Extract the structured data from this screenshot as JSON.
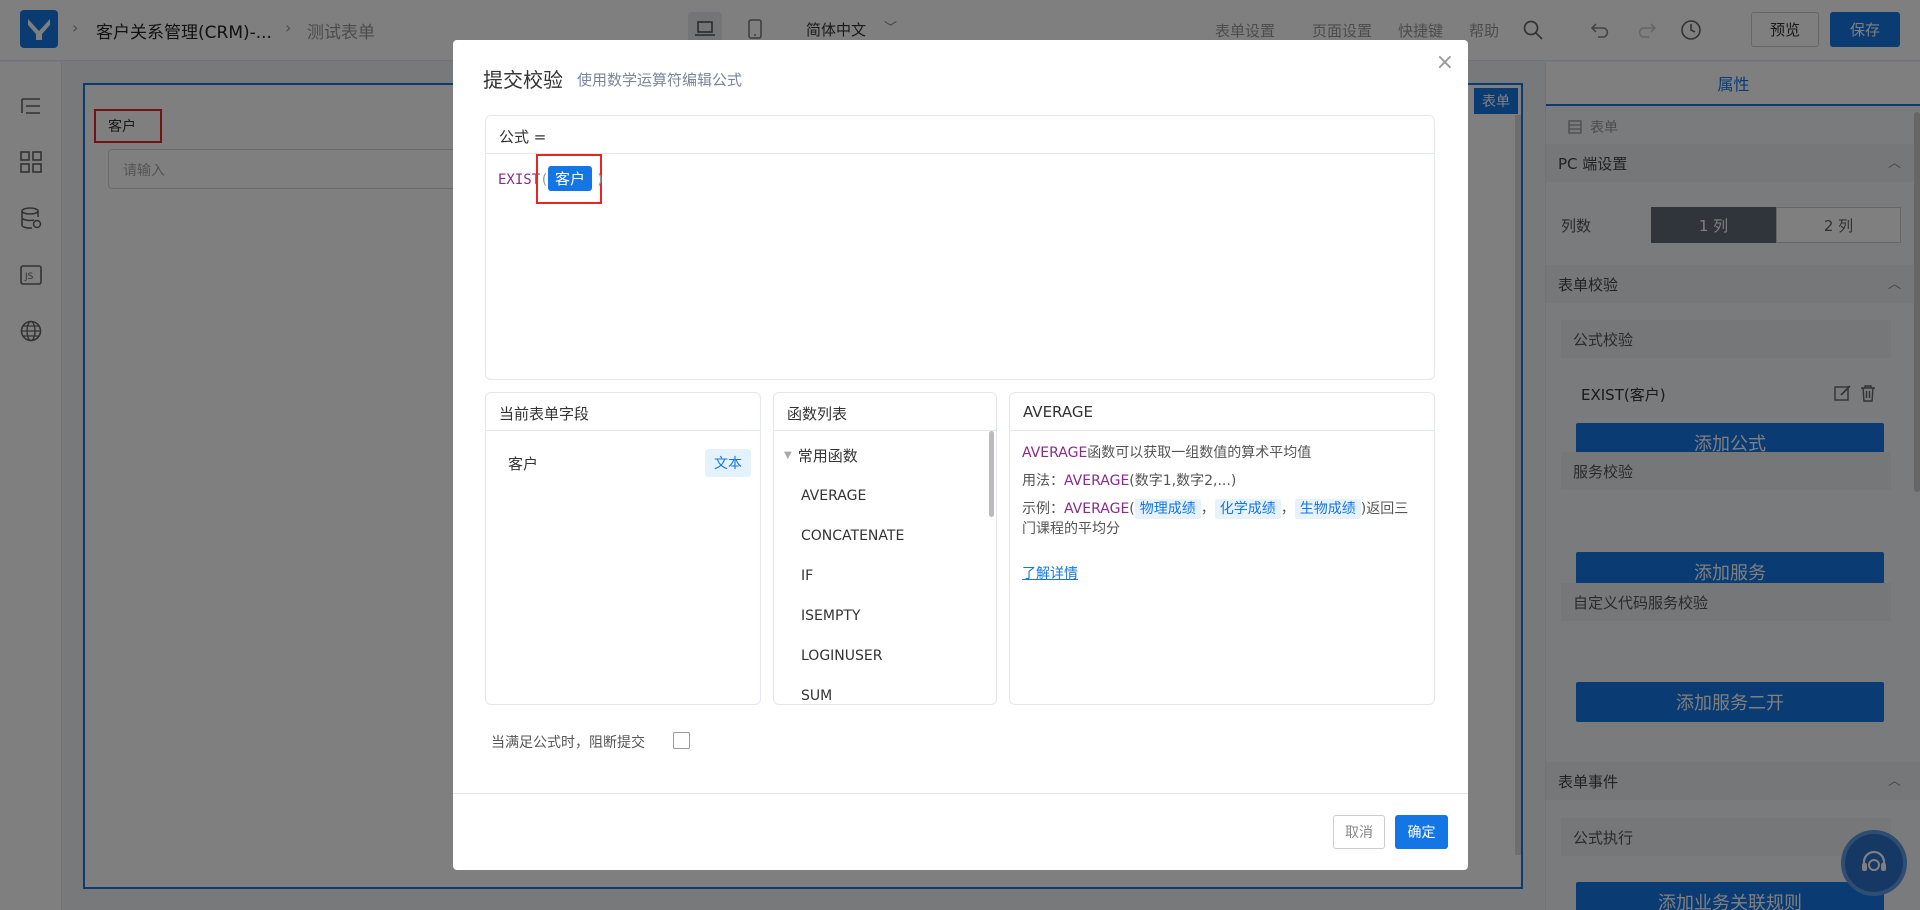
{
  "topbar": {
    "app_name": "客户关系管理(CRM)-...",
    "current_form": "测试表单",
    "language": "简体中文",
    "links": [
      "表单设置",
      "页面设置",
      "快捷键",
      "帮助"
    ],
    "preview_label": "预览",
    "save_label": "保存"
  },
  "canvas": {
    "tag": "表单",
    "field_label": "客户",
    "field_placeholder": "请输入"
  },
  "props": {
    "tab": "属性",
    "type_label": "表单",
    "pc_settings": "PC 端设置",
    "columns_label": "列数",
    "col_1": "1 列",
    "col_2": "2 列",
    "form_validation": "表单校验",
    "formula_validation": "公式校验",
    "formula_rule": "EXIST(客户)",
    "add_formula": "添加公式",
    "service_validation": "服务校验",
    "add_service": "添加服务",
    "custom_code_validation": "自定义代码服务校验",
    "add_service_2": "添加服务二开",
    "form_events": "表单事件",
    "formula_exec": "公式执行",
    "add_biz_rule": "添加业务关联规则"
  },
  "modal": {
    "title": "提交校验",
    "subtitle": "使用数学运算符编辑公式",
    "formula_header": "公式 =",
    "formula_func": "EXIST",
    "formula_field": "客户",
    "fields_header": "当前表单字段",
    "field_name": "客户",
    "field_type": "文本",
    "functions_header": "函数列表",
    "function_group": "常用函数",
    "functions": [
      "AVERAGE",
      "CONCATENATE",
      "IF",
      "ISEMPTY",
      "LOGINUSER",
      "SUM"
    ],
    "desc_header": "AVERAGE",
    "desc_func": "AVERAGE",
    "desc_text": "函数可以获取一组数值的算术平均值",
    "usage_prefix": "用法：",
    "usage_func": "AVERAGE",
    "usage_args": "(数字1,数字2,...)",
    "example_prefix": "示例：",
    "example_func": "AVERAGE",
    "example_args": [
      "物理成绩",
      "化学成绩",
      "生物成绩"
    ],
    "example_suffix": ")返回三门课程的平均分",
    "learn_more": "了解详情",
    "block_submit": "当满足公式时，阻断提交",
    "cancel": "取消",
    "confirm": "确定"
  },
  "colors": {
    "primary": "#1476e4",
    "highlight": "#e62525",
    "function": "#8a2a8a"
  }
}
